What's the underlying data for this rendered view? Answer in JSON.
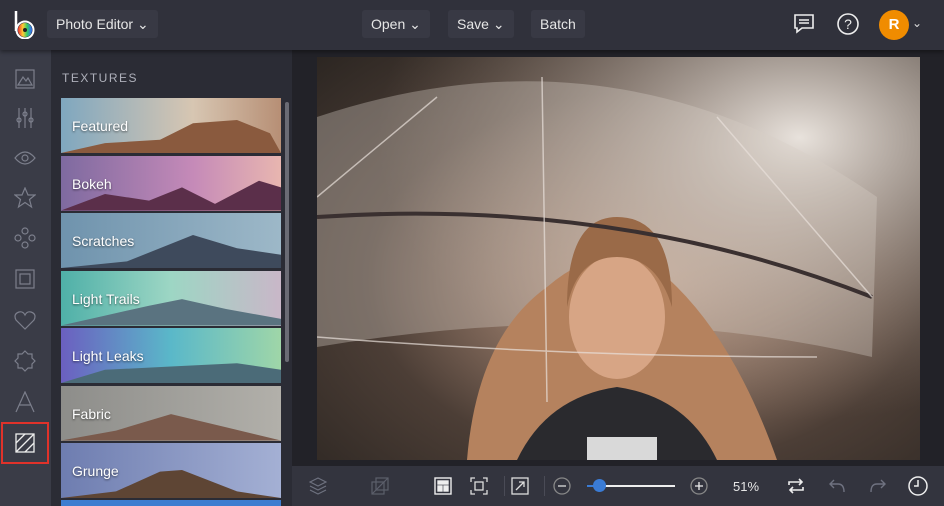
{
  "topbar": {
    "app_menu": "Photo Editor",
    "open": "Open",
    "save": "Save",
    "batch": "Batch",
    "avatar_initial": "R"
  },
  "panel": {
    "title": "TEXTURES",
    "items": [
      {
        "label": "Featured"
      },
      {
        "label": "Bokeh"
      },
      {
        "label": "Scratches"
      },
      {
        "label": "Light Trails"
      },
      {
        "label": "Light Leaks"
      },
      {
        "label": "Fabric"
      },
      {
        "label": "Grunge"
      }
    ]
  },
  "toolbar": {
    "zoom": "51%",
    "zoom_fraction": 0.14
  },
  "colors": {
    "accent": "#3a7bd5",
    "selected_border": "#e0322a",
    "avatar": "#f08c00"
  }
}
